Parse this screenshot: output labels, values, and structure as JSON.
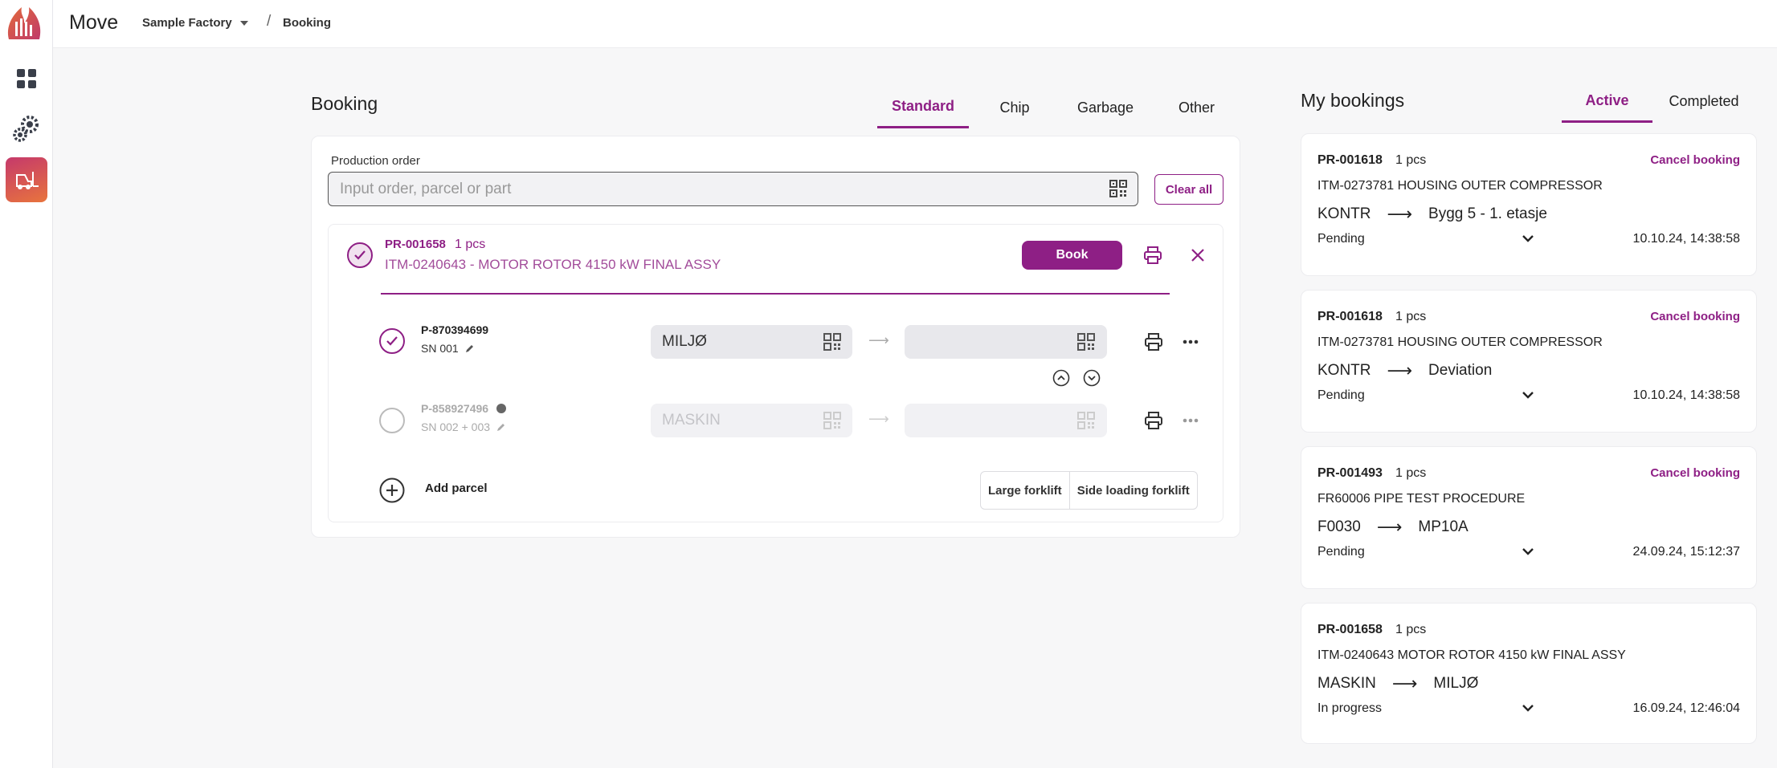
{
  "app": {
    "name": "Move",
    "factory": "Sample Factory",
    "breadcrumb_sep": "/",
    "breadcrumb": "Booking"
  },
  "colors": {
    "accent": "#8e1f85",
    "rail_active_from": "#c5396b",
    "rail_active_to": "#e8743d"
  },
  "rail": {
    "items": [
      {
        "icon": "dashboard-grid-icon"
      },
      {
        "icon": "gears-icon"
      },
      {
        "icon": "forklift-icon",
        "active": true
      }
    ]
  },
  "booking": {
    "title": "Booking",
    "tabs": [
      {
        "label": "Standard",
        "active": true
      },
      {
        "label": "Chip"
      },
      {
        "label": "Garbage"
      },
      {
        "label": "Other"
      }
    ],
    "production_order_label": "Production order",
    "search_placeholder": "Input order, parcel or part",
    "clear_all": "Clear all",
    "order": {
      "id": "PR-001658",
      "pcs": "1 pcs",
      "description": "ITM-0240643 - MOTOR ROTOR 4150 kW FINAL ASSY",
      "book": "Book"
    },
    "parcels": [
      {
        "id": "P-870394699",
        "sn": "SN 001",
        "from": "MILJØ",
        "to": "",
        "selected": true
      },
      {
        "id": "P-858927496",
        "sn": "SN 002 + 003",
        "from": "MASKIN",
        "to": "",
        "selected": false
      }
    ],
    "add_parcel": "Add parcel",
    "forklifts": [
      "Large forklift",
      "Side loading forklift"
    ]
  },
  "my_bookings": {
    "title": "My bookings",
    "tabs": [
      {
        "label": "Active",
        "active": true
      },
      {
        "label": "Completed"
      }
    ],
    "items": [
      {
        "id": "PR-001618",
        "pcs": "1 pcs",
        "cancel": "Cancel booking",
        "item": "ITM-0273781 HOUSING OUTER COMPRESSOR",
        "from": "KONTR",
        "to": "Bygg 5 - 1. etasje",
        "status": "Pending",
        "time": "10.10.24, 14:38:58"
      },
      {
        "id": "PR-001618",
        "pcs": "1 pcs",
        "cancel": "Cancel booking",
        "item": "ITM-0273781 HOUSING OUTER COMPRESSOR",
        "from": "KONTR",
        "to": "Deviation",
        "status": "Pending",
        "time": "10.10.24, 14:38:58"
      },
      {
        "id": "PR-001493",
        "pcs": "1 pcs",
        "cancel": "Cancel booking",
        "item": "FR60006 PIPE TEST PROCEDURE",
        "from": "F0030",
        "to": "MP10A",
        "status": "Pending",
        "time": "24.09.24, 15:12:37"
      },
      {
        "id": "PR-001658",
        "pcs": "1 pcs",
        "cancel": "",
        "item": "ITM-0240643 MOTOR ROTOR 4150 kW FINAL ASSY",
        "from": "MASKIN",
        "to": "MILJØ",
        "status": "In progress",
        "time": "16.09.24, 12:46:04"
      }
    ]
  }
}
